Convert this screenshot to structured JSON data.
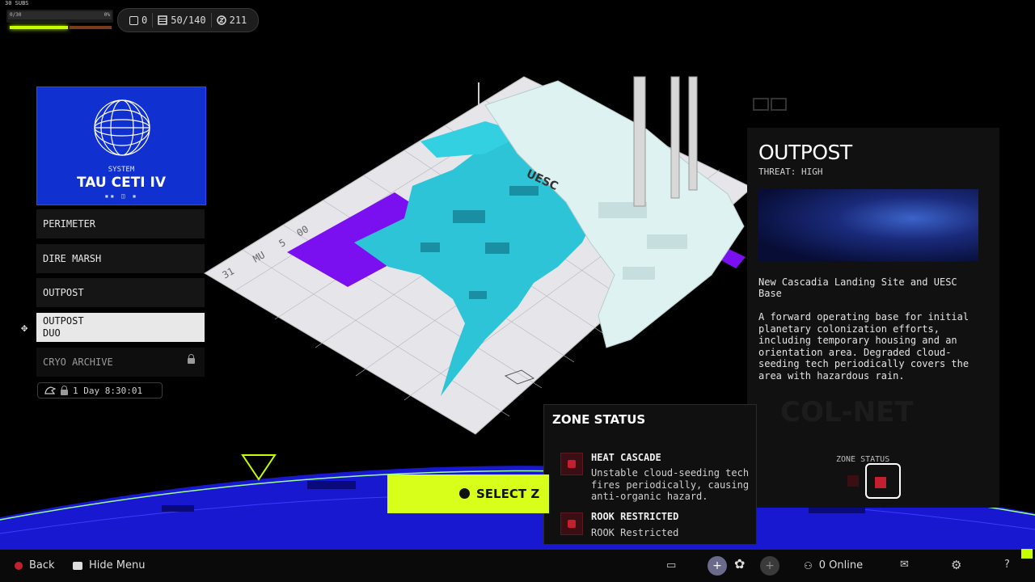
{
  "hud": {
    "subs_label": "30 SUBS",
    "progress_left": "0/30",
    "progress_right": "0%",
    "stats": [
      {
        "icon": "scrap-icon",
        "value": "0"
      },
      {
        "icon": "storage-icon",
        "value": "50/140"
      },
      {
        "icon": "credits-icon",
        "value": "211"
      }
    ]
  },
  "system": {
    "label": "SYSTEM",
    "name": "TAU CETI IV",
    "icon": "planet-globe-icon"
  },
  "zones": [
    {
      "label": "PERIMETER",
      "state": "normal"
    },
    {
      "label": "DIRE MARSH",
      "state": "normal"
    },
    {
      "label": "OUTPOST",
      "state": "normal"
    },
    {
      "label": "OUTPOST\nDUO",
      "state": "active"
    },
    {
      "label": "CRYO ARCHIVE",
      "state": "locked"
    }
  ],
  "timer": "1 Day 8:30:01",
  "map": {
    "label_uesc": "UESC",
    "floor_labels": [
      "31",
      "MU",
      "5",
      "00"
    ]
  },
  "outpost": {
    "title": "OUTPOST",
    "threat": "THREAT: HIGH",
    "name": "New Cascadia Landing Site and UESC Base",
    "description": "A forward operating base for initial planetary colonization efforts, including temporary housing and an orientation area. Degraded cloud-seeding tech periodically covers the area with hazardous rain.",
    "zone_status_label": "ZONE STATUS",
    "background_text": "COL-NET"
  },
  "zone_status": {
    "title": "ZONE STATUS",
    "hazards": [
      {
        "title": "HEAT CASCADE",
        "description": "Unstable cloud-seeding tech fires periodically, causing anti-organic hazard."
      },
      {
        "title": "ROOK RESTRICTED",
        "description": "ROOK Restricted"
      }
    ]
  },
  "select_button": "SELECT Z",
  "bottom_bar": {
    "back": "Back",
    "hide_menu": "Hide Menu",
    "online": "0 Online",
    "help": "?"
  },
  "colors": {
    "accent_lime": "#d8ff1a",
    "system_blue": "#1030d0",
    "map_cyan": "#2ec4d8",
    "map_purple": "#7a10f0",
    "hazard_red": "#c2202e"
  }
}
